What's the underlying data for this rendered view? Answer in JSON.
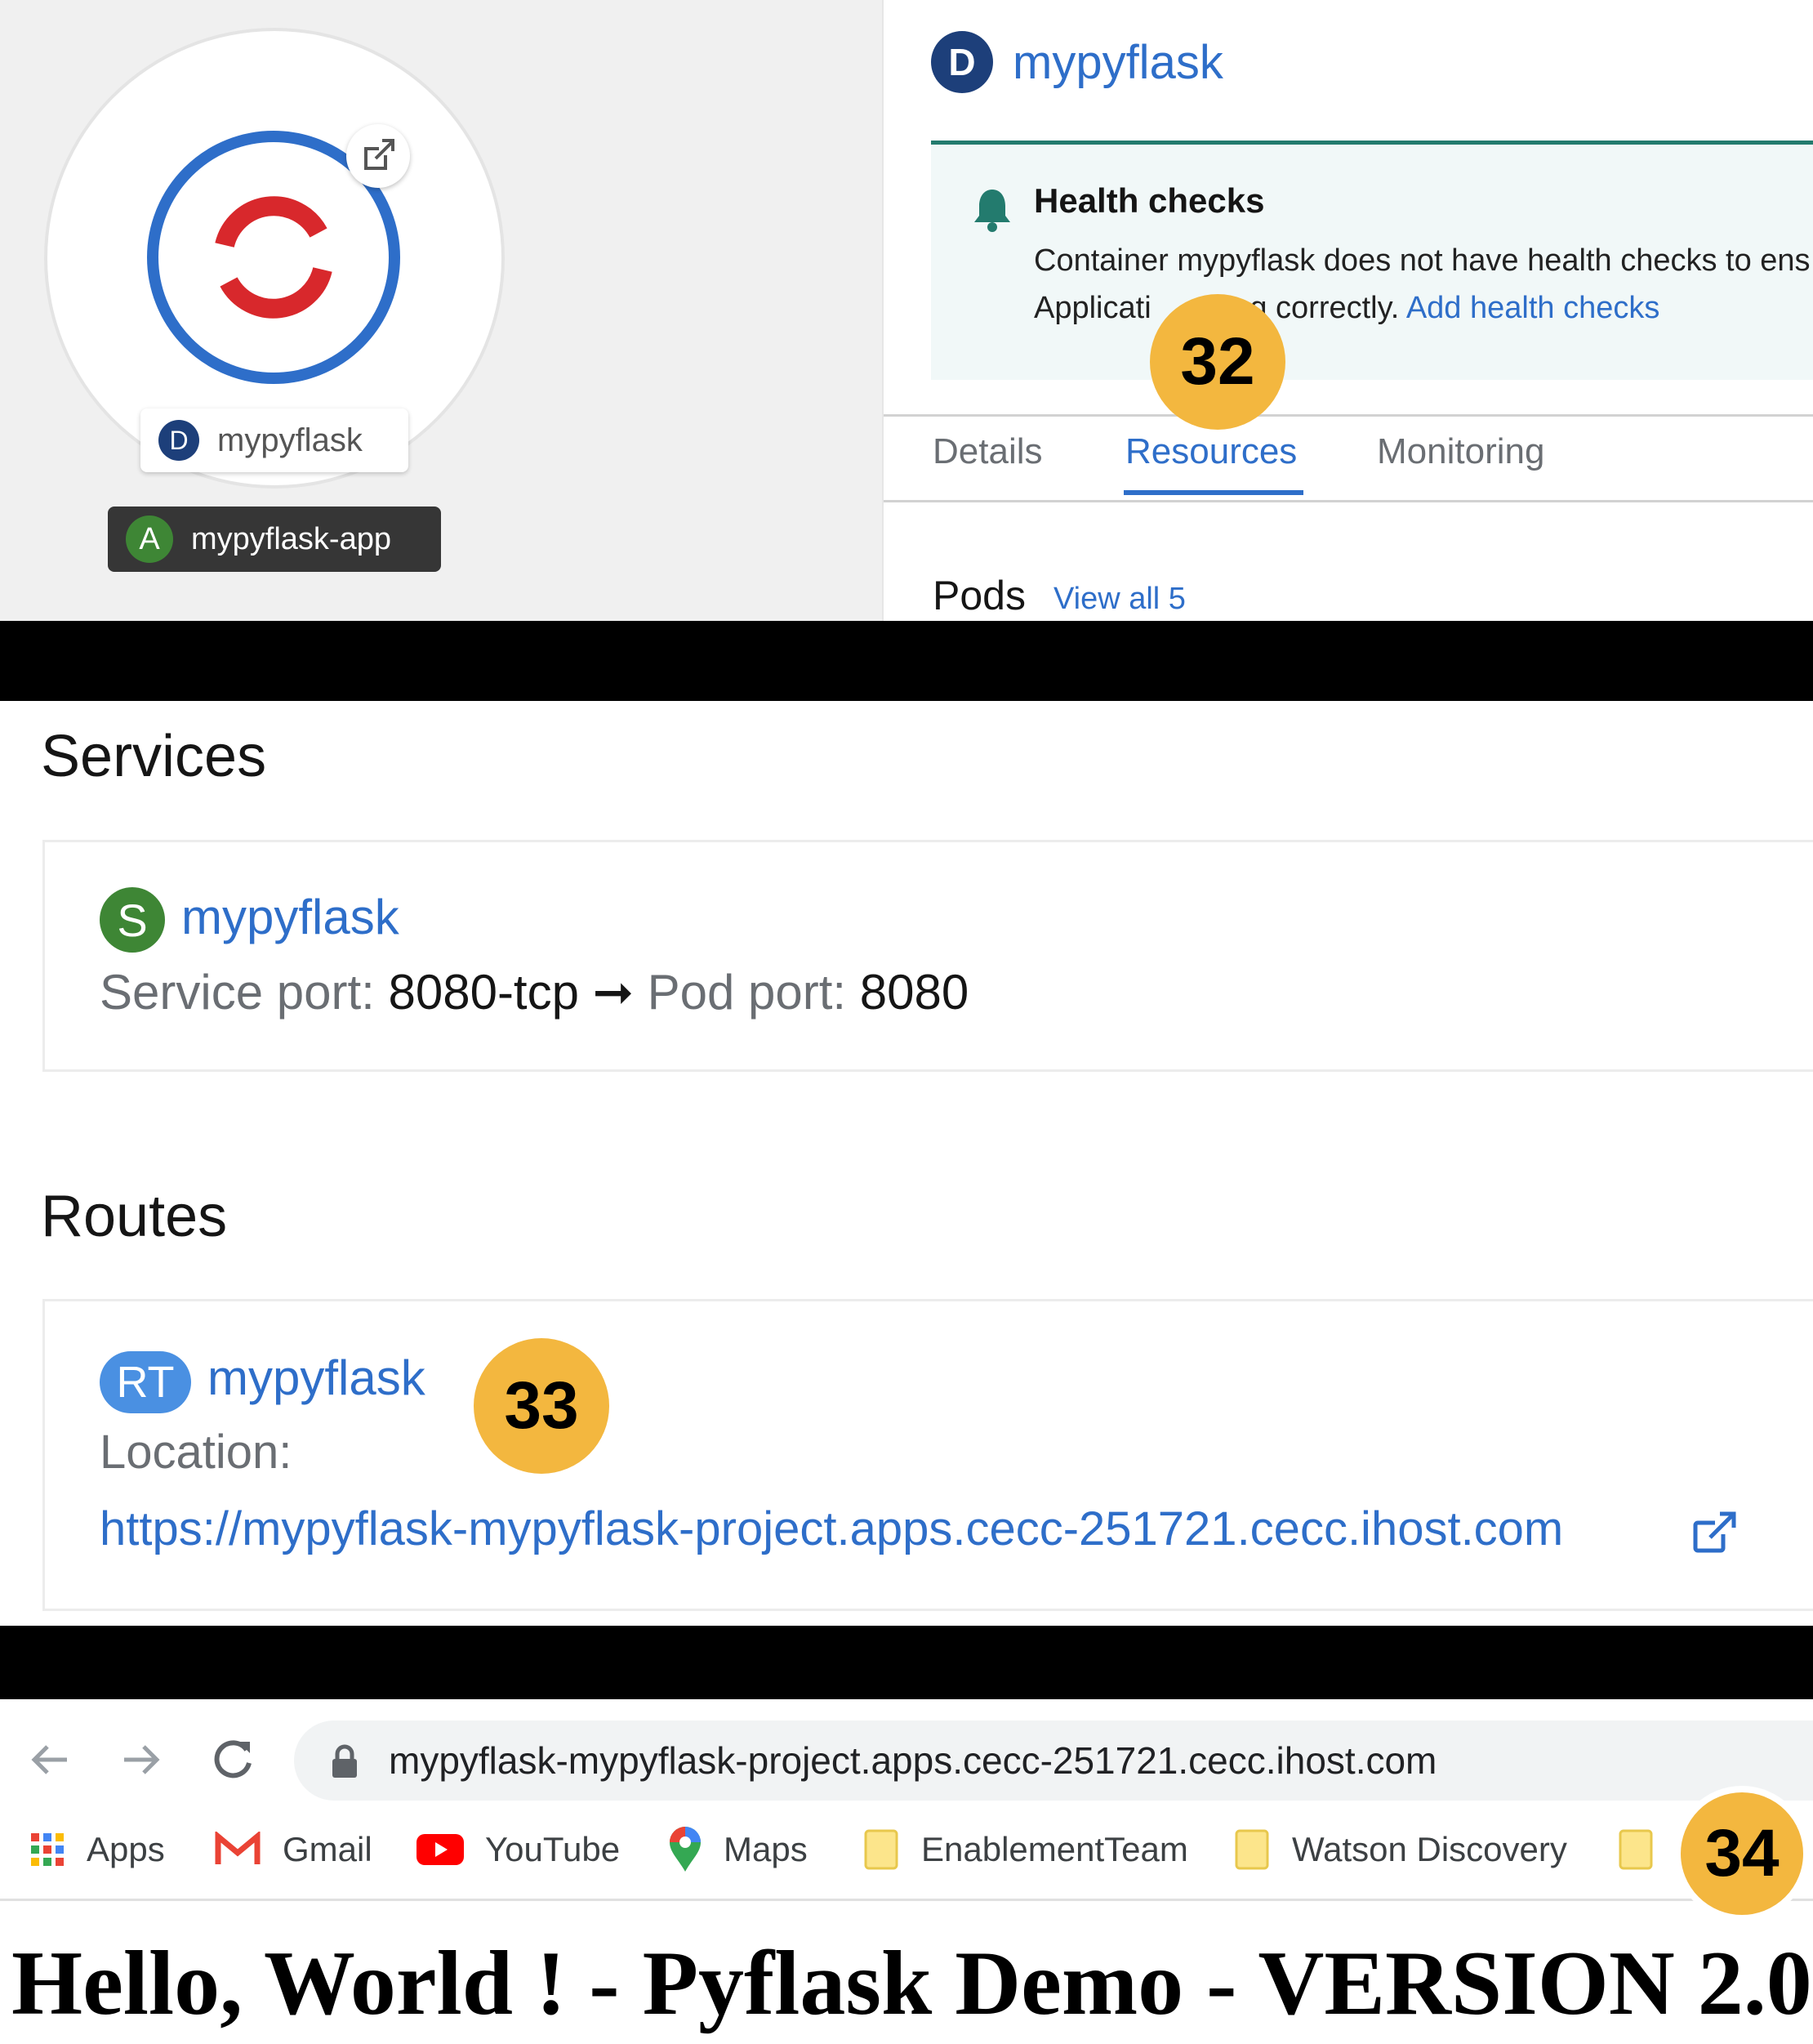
{
  "topology": {
    "node_badge": "D",
    "node_label": "mypyflask",
    "app_badge": "A",
    "app_label": "mypyflask-app"
  },
  "side_panel": {
    "title_badge": "D",
    "title": "mypyflask",
    "alert": {
      "title": "Health checks",
      "line1": "Container mypyflask does not have health checks to ens",
      "line2_prefix": "Applicati",
      "line2_mid": "ning correctly. ",
      "link": "Add health checks"
    },
    "tabs": [
      "Details",
      "Resources",
      "Monitoring"
    ],
    "active_tab": "Resources",
    "pods_label": "Pods",
    "pods_link": "View all 5"
  },
  "services": {
    "heading": "Services",
    "badge": "S",
    "name": "mypyflask",
    "port_label": "Service port:",
    "port_value": "8080-tcp",
    "arrow": "➞",
    "pod_port_label": "Pod port:",
    "pod_port_value": "8080"
  },
  "routes": {
    "heading": "Routes",
    "badge": "RT",
    "name": "mypyflask",
    "location_label": "Location:",
    "url": "https://mypyflask-mypyflask-project.apps.cecc-251721.cecc.ihost.com"
  },
  "browser": {
    "address": "mypyflask-mypyflask-project.apps.cecc-251721.cecc.ihost.com",
    "bookmarks": [
      "Apps",
      "Gmail",
      "YouTube",
      "Maps",
      "EnablementTeam",
      "Watson Discovery"
    ],
    "page_heading": "Hello, World ! - Pyflask Demo - VERSION 2.0"
  },
  "callouts": [
    "32",
    "33",
    "34"
  ],
  "colors": {
    "link_blue": "#2e6ec9",
    "deployment_badge": "#1d3f7a",
    "app_badge": "#3e8635",
    "callout": "#f3b73f",
    "alert_border": "#237b6e"
  }
}
